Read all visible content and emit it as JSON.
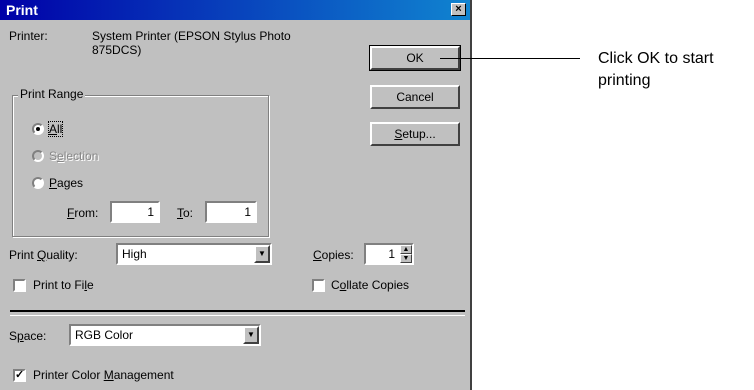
{
  "dialog": {
    "title": "Print",
    "close_glyph": "×",
    "printer_label": "Printer:",
    "printer_name_line1": "System Printer (EPSON Stylus Photo",
    "printer_name_line2": "875DCS)",
    "buttons": {
      "ok": "OK",
      "cancel": "Cancel",
      "setup": "Setup..."
    },
    "print_range": {
      "label": "Print Range",
      "all": "All",
      "selection": "Selection",
      "pages": "Pages",
      "selected": "All",
      "from_label": "From:",
      "from_value": "1",
      "to_label": "To:",
      "to_value": "1"
    },
    "print_quality": {
      "label": "Print Quality:",
      "value": "High"
    },
    "copies": {
      "label": "Copies:",
      "value": "1"
    },
    "print_to_file": {
      "label": "Print to File",
      "checked": false
    },
    "collate_copies": {
      "label": "Collate Copies",
      "checked": false
    },
    "space": {
      "label": "Space:",
      "value": "RGB Color"
    },
    "color_management": {
      "label": "Printer Color Management",
      "checked": true
    }
  },
  "annotation": {
    "line1": "Click OK to start",
    "line2": "printing"
  },
  "icons": {
    "check": "✓",
    "dropdown_arrow": "▼",
    "spin_up": "▲",
    "spin_down": "▼"
  }
}
